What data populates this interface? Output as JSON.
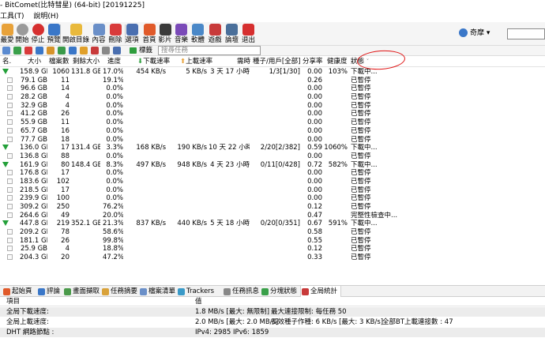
{
  "window": {
    "title": "- BitComet(比特彗星) (64-bit) [20191225]"
  },
  "menu": [
    "工具(T)",
    "說明(H)"
  ],
  "toolbar": {
    "buttons": [
      {
        "label": "最愛",
        "color": "#e8a23a"
      },
      {
        "label": "開始",
        "color": "#9a9a9a"
      },
      {
        "label": "停止",
        "color": "#d62f2f"
      },
      {
        "label": "預覽",
        "color": "#3a77c8"
      },
      {
        "label": "開啟目錄",
        "color": "#e9b93c"
      },
      {
        "label": "內容",
        "color": "#6a8fc8"
      },
      {
        "label": "刪除",
        "color": "#d93b3b"
      },
      {
        "label": "選項",
        "color": "#4a6fb0"
      },
      {
        "label": "首頁",
        "color": "#e05a2a"
      },
      {
        "label": "影片",
        "color": "#3a3a3a"
      },
      {
        "label": "音樂",
        "color": "#7a4ab8"
      },
      {
        "label": "軟體",
        "color": "#4a88c8"
      },
      {
        "label": "遊戲",
        "color": "#c83a3a"
      },
      {
        "label": "論壇",
        "color": "#4a6f9a"
      },
      {
        "label": "退出",
        "color": "#d62f2f"
      }
    ],
    "user_label": "奇摩 ▾"
  },
  "toolbar2": {
    "tag_label": "標籤",
    "search_placeholder": "搜尋任務"
  },
  "table": {
    "headers": [
      "名.",
      "大小",
      "檔案數",
      "剩餘大小",
      "進度",
      "下載速率",
      "上載速率",
      "需時",
      "種子/用戶[全部]",
      "分享率",
      "健康度",
      "狀態"
    ],
    "rows": [
      {
        "type": "task",
        "size": "158.9 GB",
        "files": "1060",
        "remaining": "131.8 GB",
        "progress": "17.0%",
        "down": "454 KB/s",
        "up": "5 KB/s",
        "eta": "3 天 17 小時",
        "peers": "1/3[1/30]",
        "ratio": "0.00",
        "health": "103%",
        "status": "下載中..."
      },
      {
        "type": "sub",
        "size": "79.1 GB",
        "files": "11",
        "remaining": "",
        "progress": "19.1%",
        "down": "",
        "up": "",
        "eta": "",
        "peers": "",
        "ratio": "0.26",
        "health": "",
        "status": "已暫停"
      },
      {
        "type": "sub",
        "size": "96.6 GB",
        "files": "14",
        "remaining": "",
        "progress": "0.0%",
        "down": "",
        "up": "",
        "eta": "",
        "peers": "",
        "ratio": "0.00",
        "health": "",
        "status": "已暫停"
      },
      {
        "type": "sub",
        "size": "28.2 GB",
        "files": "4",
        "remaining": "",
        "progress": "0.0%",
        "down": "",
        "up": "",
        "eta": "",
        "peers": "",
        "ratio": "0.00",
        "health": "",
        "status": "已暫停"
      },
      {
        "type": "sub",
        "size": "32.9 GB",
        "files": "4",
        "remaining": "",
        "progress": "0.0%",
        "down": "",
        "up": "",
        "eta": "",
        "peers": "",
        "ratio": "0.00",
        "health": "",
        "status": "已暫停"
      },
      {
        "type": "sub",
        "size": "41.2 GB",
        "files": "26",
        "remaining": "",
        "progress": "0.0%",
        "down": "",
        "up": "",
        "eta": "",
        "peers": "",
        "ratio": "0.00",
        "health": "",
        "status": "已暫停"
      },
      {
        "type": "sub",
        "size": "55.9 GB",
        "files": "11",
        "remaining": "",
        "progress": "0.0%",
        "down": "",
        "up": "",
        "eta": "",
        "peers": "",
        "ratio": "0.00",
        "health": "",
        "status": "已暫停"
      },
      {
        "type": "sub",
        "size": "65.7 GB",
        "files": "16",
        "remaining": "",
        "progress": "0.0%",
        "down": "",
        "up": "",
        "eta": "",
        "peers": "",
        "ratio": "0.00",
        "health": "",
        "status": "已暫停"
      },
      {
        "type": "sub",
        "size": "77.7 GB",
        "files": "18",
        "remaining": "",
        "progress": "0.0%",
        "down": "",
        "up": "",
        "eta": "",
        "peers": "",
        "ratio": "0.00",
        "health": "",
        "status": "已暫停"
      },
      {
        "type": "task",
        "size": "136.0 GB",
        "files": "17",
        "remaining": "131.4 GB",
        "progress": "3.3%",
        "down": "168 KB/s",
        "up": "190 KB/s",
        "eta": "10 天 22 小時",
        "peers": "2/20[2/382]",
        "ratio": "0.59",
        "health": "1060%",
        "status": "下載中..."
      },
      {
        "type": "sub",
        "size": "136.8 GB",
        "files": "88",
        "remaining": "",
        "progress": "0.0%",
        "down": "",
        "up": "",
        "eta": "",
        "peers": "",
        "ratio": "0.00",
        "health": "",
        "status": "已暫停"
      },
      {
        "type": "task",
        "size": "161.9 GB",
        "files": "80",
        "remaining": "148.4 GB",
        "progress": "8.3%",
        "down": "497 KB/s",
        "up": "948 KB/s",
        "eta": "4 天 23 小時",
        "peers": "0/11[0/428]",
        "ratio": "0.72",
        "health": "582%",
        "status": "下載中..."
      },
      {
        "type": "sub",
        "size": "176.8 GB",
        "files": "17",
        "remaining": "",
        "progress": "0.0%",
        "down": "",
        "up": "",
        "eta": "",
        "peers": "",
        "ratio": "0.00",
        "health": "",
        "status": "已暫停"
      },
      {
        "type": "sub",
        "size": "183.6 GB",
        "files": "102",
        "remaining": "",
        "progress": "0.0%",
        "down": "",
        "up": "",
        "eta": "",
        "peers": "",
        "ratio": "0.00",
        "health": "",
        "status": "已暫停"
      },
      {
        "type": "sub",
        "size": "218.5 GB",
        "files": "17",
        "remaining": "",
        "progress": "0.0%",
        "down": "",
        "up": "",
        "eta": "",
        "peers": "",
        "ratio": "0.00",
        "health": "",
        "status": "已暫停"
      },
      {
        "type": "sub",
        "size": "239.9 GB",
        "files": "100",
        "remaining": "",
        "progress": "0.0%",
        "down": "",
        "up": "",
        "eta": "",
        "peers": "",
        "ratio": "0.00",
        "health": "",
        "status": "已暫停"
      },
      {
        "type": "sub",
        "size": "309.2 GB",
        "files": "250",
        "remaining": "",
        "progress": "76.2%",
        "down": "",
        "up": "",
        "eta": "",
        "peers": "",
        "ratio": "0.12",
        "health": "",
        "status": "已暫停"
      },
      {
        "type": "sub",
        "size": "264.6 GB",
        "files": "49",
        "remaining": "",
        "progress": "20.0%",
        "down": "",
        "up": "",
        "eta": "",
        "peers": "",
        "ratio": "0.47",
        "health": "",
        "status": "完整性檢查中..."
      },
      {
        "type": "task",
        "size": "447.8 GB",
        "files": "219",
        "remaining": "352.1 GB",
        "progress": "21.3%",
        "down": "837 KB/s",
        "up": "440 KB/s",
        "eta": "5 天 18 小時",
        "peers": "0/20[0/351]",
        "ratio": "0.67",
        "health": "591%",
        "status": "下載中..."
      },
      {
        "type": "sub",
        "size": "209.2 GB",
        "files": "78",
        "remaining": "",
        "progress": "58.6%",
        "down": "",
        "up": "",
        "eta": "",
        "peers": "",
        "ratio": "0.58",
        "health": "",
        "status": "已暫停"
      },
      {
        "type": "sub",
        "size": "181.1 GB",
        "files": "26",
        "remaining": "",
        "progress": "99.8%",
        "down": "",
        "up": "",
        "eta": "",
        "peers": "",
        "ratio": "0.55",
        "health": "",
        "status": "已暫停"
      },
      {
        "type": "sub",
        "size": "25.9 GB",
        "files": "4",
        "remaining": "",
        "progress": "18.8%",
        "down": "",
        "up": "",
        "eta": "",
        "peers": "",
        "ratio": "0.12",
        "health": "",
        "status": "已暫停"
      },
      {
        "type": "sub",
        "size": "204.3 GB",
        "files": "20",
        "remaining": "",
        "progress": "47.2%",
        "down": "",
        "up": "",
        "eta": "",
        "peers": "",
        "ratio": "0.33",
        "health": "",
        "status": "已暫停"
      }
    ]
  },
  "bottom_tabs": [
    {
      "label": "起始頁",
      "color": "#e05a2a"
    },
    {
      "label": "評論",
      "color": "#3a77c8"
    },
    {
      "label": "畫面擷取",
      "color": "#4a9a4a"
    },
    {
      "label": "任務摘要",
      "color": "#d9a23a"
    },
    {
      "label": "檔案清單",
      "color": "#6a8fc8"
    },
    {
      "label": "Trackers",
      "color": "#3a9ac8"
    },
    {
      "label": "任務訊息",
      "color": "#888888"
    },
    {
      "label": "分塊狀態",
      "color": "#3aa04a"
    },
    {
      "label": "全局統計",
      "color": "#c83a3a"
    }
  ],
  "stats": {
    "col_item": "項目",
    "col_value": "值",
    "rows": [
      {
        "item": "全局下載速度:",
        "value": "1.8 MB/s [最大: 無限制]",
        "extra1": "最大連接限制: 每任務 50",
        "extra2": ""
      },
      {
        "item": "全局上載速度:",
        "value": "2.0 MB/s [最大: 2.0 MB/s]",
        "extra1": "長效種子作種: 6 KB/s [最大: 3 KB/s]",
        "extra2": "全部BT上載連接數 : 47"
      },
      {
        "item": "DHT 網路節點 :",
        "value": "IPv4: 2985  IPv6: 1859",
        "extra1": "",
        "extra2": ""
      }
    ]
  }
}
